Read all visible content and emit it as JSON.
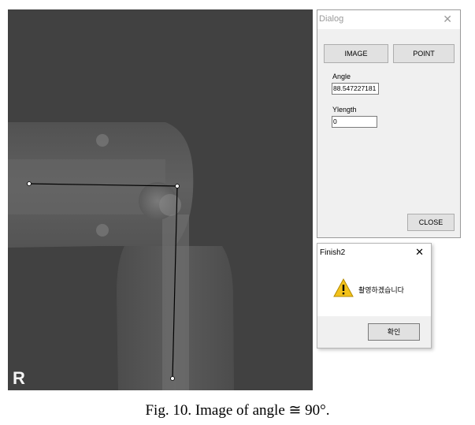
{
  "image_panel": {
    "marker": "R"
  },
  "dialog": {
    "title": "Dialog",
    "close_glyph": "✕",
    "image_button": "IMAGE",
    "point_button": "POINT",
    "angle_label": "Angle",
    "angle_value": "88.547227181",
    "ylength_label": "Ylength",
    "ylength_value": "0",
    "close_button": "CLOSE"
  },
  "message_box": {
    "title": "Finish2",
    "close_glyph": "✕",
    "icon": "warning-icon",
    "message": "촬영하겠습니다",
    "ok_button": "확인"
  },
  "caption": "Fig. 10. Image of angle  ≅  90°."
}
